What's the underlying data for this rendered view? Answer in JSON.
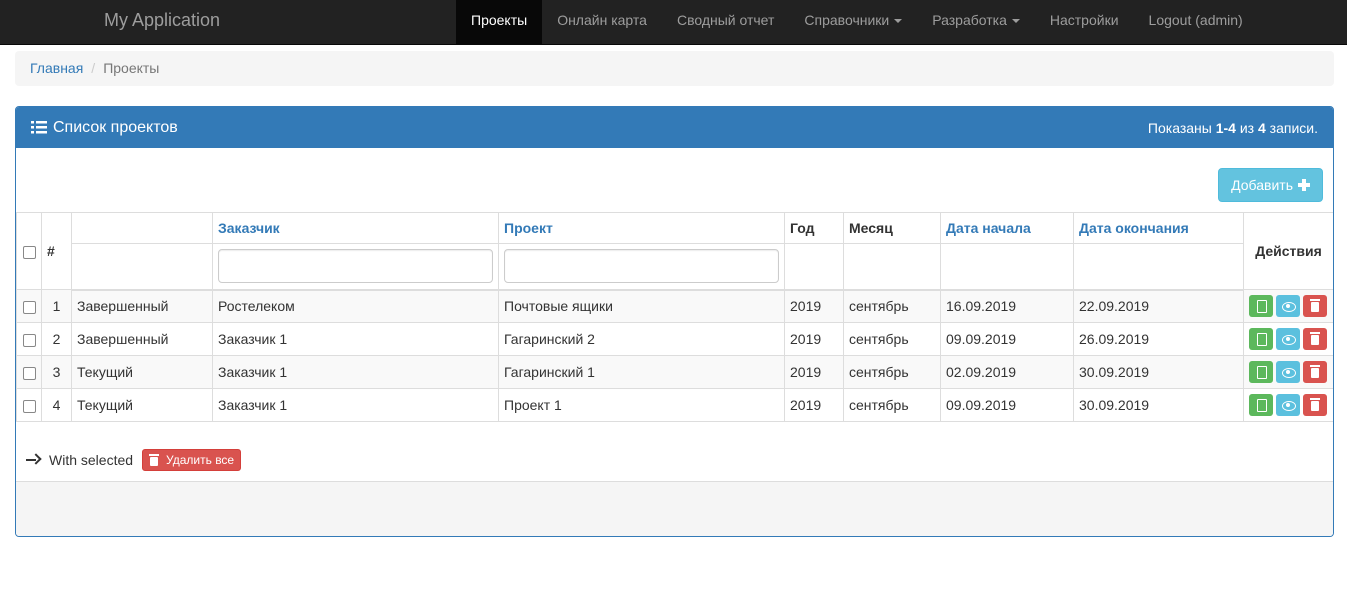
{
  "navbar": {
    "brand": "My Application",
    "items": [
      {
        "label": "Проекты",
        "active": true
      },
      {
        "label": "Онлайн карта"
      },
      {
        "label": "Сводный отчет"
      },
      {
        "label": "Справочники",
        "dropdown": true
      },
      {
        "label": "Разработка",
        "dropdown": true
      },
      {
        "label": "Настройки"
      },
      {
        "label": "Logout (admin)"
      }
    ]
  },
  "breadcrumb": {
    "home": "Главная",
    "current": "Проекты"
  },
  "panel": {
    "title": "Список проектов",
    "summary_prefix": "Показаны",
    "summary_range": "1-4",
    "summary_mid": "из",
    "summary_total": "4",
    "summary_suffix": "записи."
  },
  "toolbar": {
    "add_label": "Добавить"
  },
  "table": {
    "columns": {
      "num": "#",
      "customer": "Заказчик",
      "project": "Проект",
      "year": "Год",
      "month": "Месяц",
      "start": "Дата начала",
      "end": "Дата окончания",
      "actions": "Действия"
    },
    "rows": [
      {
        "num": "1",
        "status": "Завершенный",
        "customer": "Ростелеком",
        "project": "Почтовые ящики",
        "year": "2019",
        "month": "сентябрь",
        "start": "16.09.2019",
        "end": "22.09.2019"
      },
      {
        "num": "2",
        "status": "Завершенный",
        "customer": "Заказчик 1",
        "project": "Гагаринский 2",
        "year": "2019",
        "month": "сентябрь",
        "start": "09.09.2019",
        "end": "26.09.2019"
      },
      {
        "num": "3",
        "status": "Текущий",
        "customer": "Заказчик 1",
        "project": "Гагаринский 1",
        "year": "2019",
        "month": "сентябрь",
        "start": "02.09.2019",
        "end": "30.09.2019"
      },
      {
        "num": "4",
        "status": "Текущий",
        "customer": "Заказчик 1",
        "project": "Проект 1",
        "year": "2019",
        "month": "сентябрь",
        "start": "09.09.2019",
        "end": "30.09.2019"
      }
    ]
  },
  "bulk": {
    "label": "With selected",
    "delete_all": "Удалить все"
  },
  "icons": {
    "list": "list-icon",
    "plus": "plus-icon",
    "copy": "clipboard-icon",
    "view": "eye-icon",
    "delete": "trash-icon",
    "arrow": "arrow-right-icon",
    "caret": "caret-down-icon"
  },
  "colors": {
    "primary": "#337ab7",
    "info": "#5bc0de",
    "success": "#5cb85c",
    "danger": "#d9534f",
    "navbar": "#222222"
  }
}
